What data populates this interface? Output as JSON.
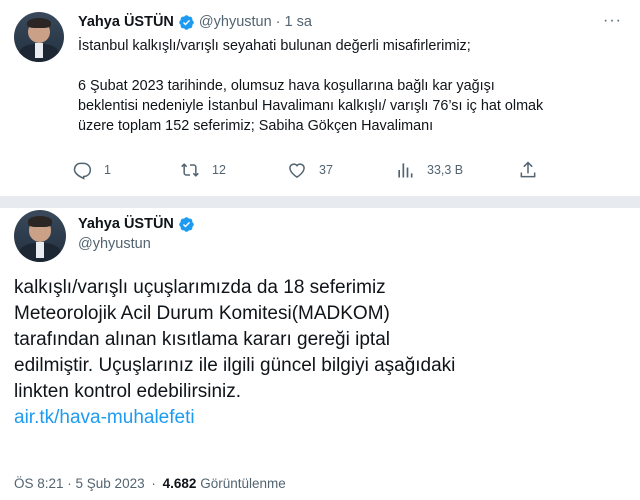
{
  "thread_tweet": {
    "author_name": "Yahya ÜSTÜN",
    "handle": "@yhyustun",
    "separator": "·",
    "time": "1 sa",
    "paragraph1": "İstanbul kalkışlı/varışlı seyahati bulunan değerli misafirlerimiz;",
    "paragraph2_lines": [
      "6 Şubat 2023 tarihinde, olumsuz hava koşullarına bağlı kar yağışı",
      "beklentisi nedeniyle İstanbul Havalimanı kalkışlı/ varışlı 76’sı iç hat olmak",
      "üzere toplam 152 seferimiz; Sabiha Gökçen Havalimanı"
    ],
    "actions": {
      "replies": "1",
      "retweets": "12",
      "likes": "37",
      "views": "33,3 B"
    }
  },
  "main_tweet": {
    "author_name": "Yahya ÜSTÜN",
    "handle": "@yhyustun",
    "text_lines": [
      "kalkışlı/varışlı uçuşlarımızda da 18 seferimiz",
      "Meteorolojik Acil Durum Komitesi(MADKOM)",
      "tarafından alınan kısıtlama kararı gereği iptal",
      "edilmiştir. Uçuşlarınız ile ilgili güncel bilgiyi  aşağıdaki",
      "linkten kontrol edebilirsiniz."
    ],
    "link": "air.tk/hava-muhalefeti",
    "timestamp": "ÖS 8:21 · 5 Şub 2023",
    "meta_sep": "·",
    "views_count": "4.682",
    "views_label": "Görüntülenme"
  },
  "colors": {
    "accent": "#1d9bf0",
    "muted": "#536471",
    "divider": "#e7ebef"
  }
}
